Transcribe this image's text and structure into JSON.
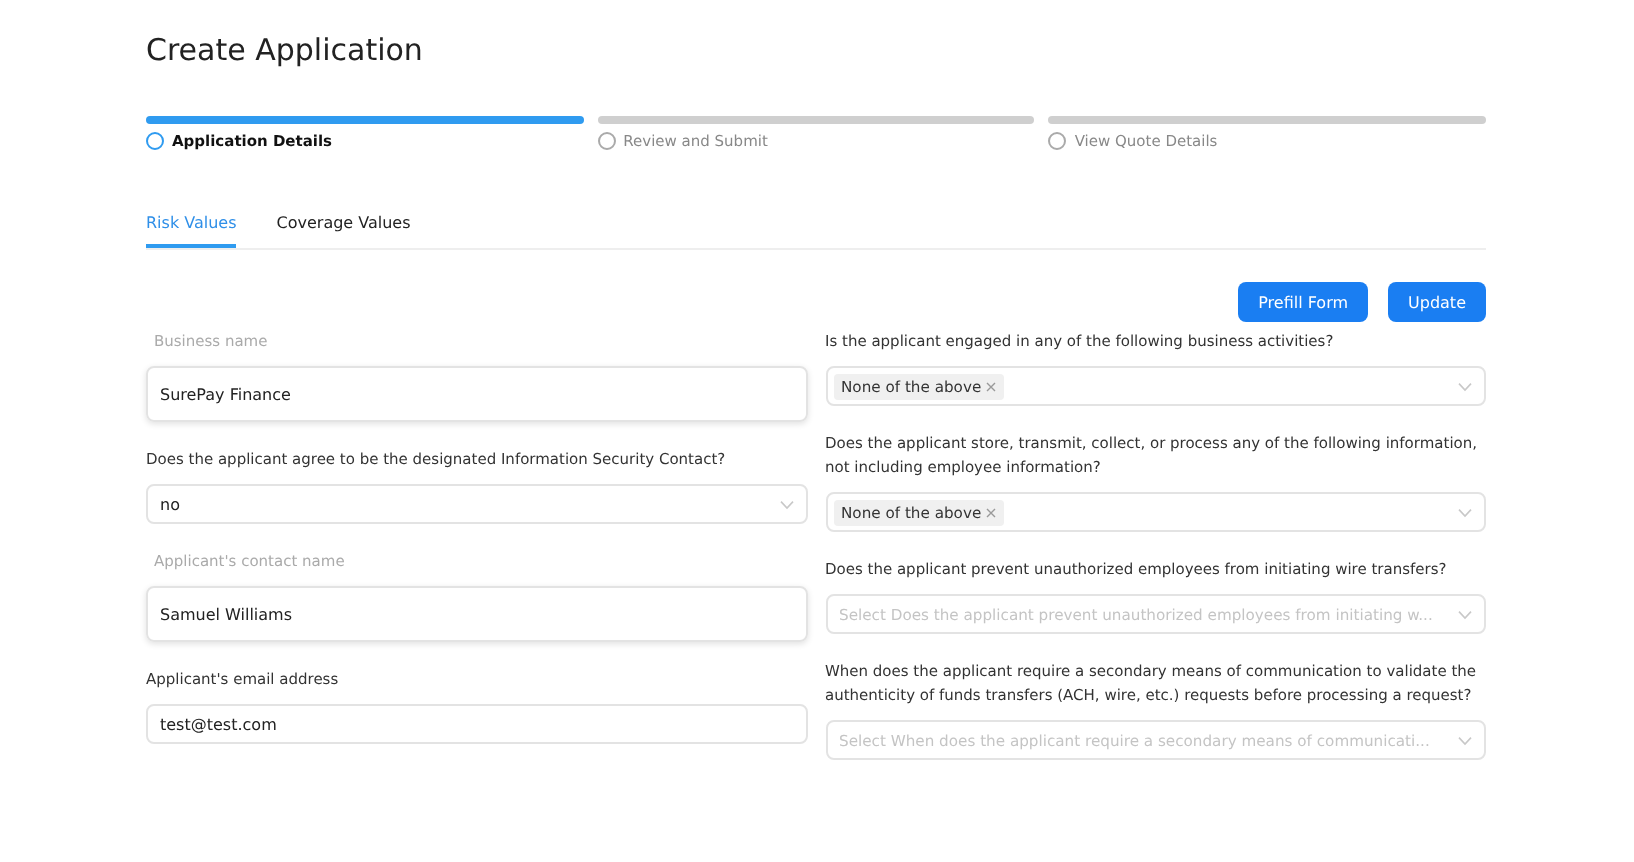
{
  "title": "Create Application",
  "steps": [
    {
      "label": "Application Details",
      "selected": true
    },
    {
      "label": "Review and Submit",
      "selected": false
    },
    {
      "label": "View Quote Details",
      "selected": false
    }
  ],
  "tabs": [
    {
      "label": "Risk Values",
      "selected": true
    },
    {
      "label": "Coverage Values",
      "selected": false
    }
  ],
  "buttons": [
    "Prefill Form",
    "Update"
  ],
  "left_fields": [
    {
      "kind": "floating",
      "label": "Business name",
      "value": "SurePay Finance"
    },
    {
      "kind": "select",
      "label": "Does the applicant agree to be the designated Information Security Contact?",
      "value": "no"
    },
    {
      "kind": "floating",
      "label": "Applicant's contact name",
      "value": "Samuel Williams"
    },
    {
      "kind": "input",
      "label": "Applicant's email address",
      "value": "test@test.com"
    }
  ],
  "right_fields": [
    {
      "kind": "tags",
      "label": "Is the applicant engaged in any of the following business activities?",
      "tags": [
        "None of the above"
      ]
    },
    {
      "kind": "tags",
      "label": "Does the applicant store, transmit, collect, or process any of the following information, not including employee information?",
      "tags": [
        "None of the above"
      ]
    },
    {
      "kind": "select",
      "label": "Does the applicant prevent unauthorized employees from initiating wire transfers?",
      "placeholder": "Select Does the applicant prevent unauthorized employees from initiating w..."
    },
    {
      "kind": "select",
      "label": "When does the applicant require a secondary means of communication to validate the authenticity of funds transfers (ACH, wire, etc.) requests before processing a request?",
      "placeholder": "Select When does the applicant require a secondary means of communicati..."
    }
  ]
}
